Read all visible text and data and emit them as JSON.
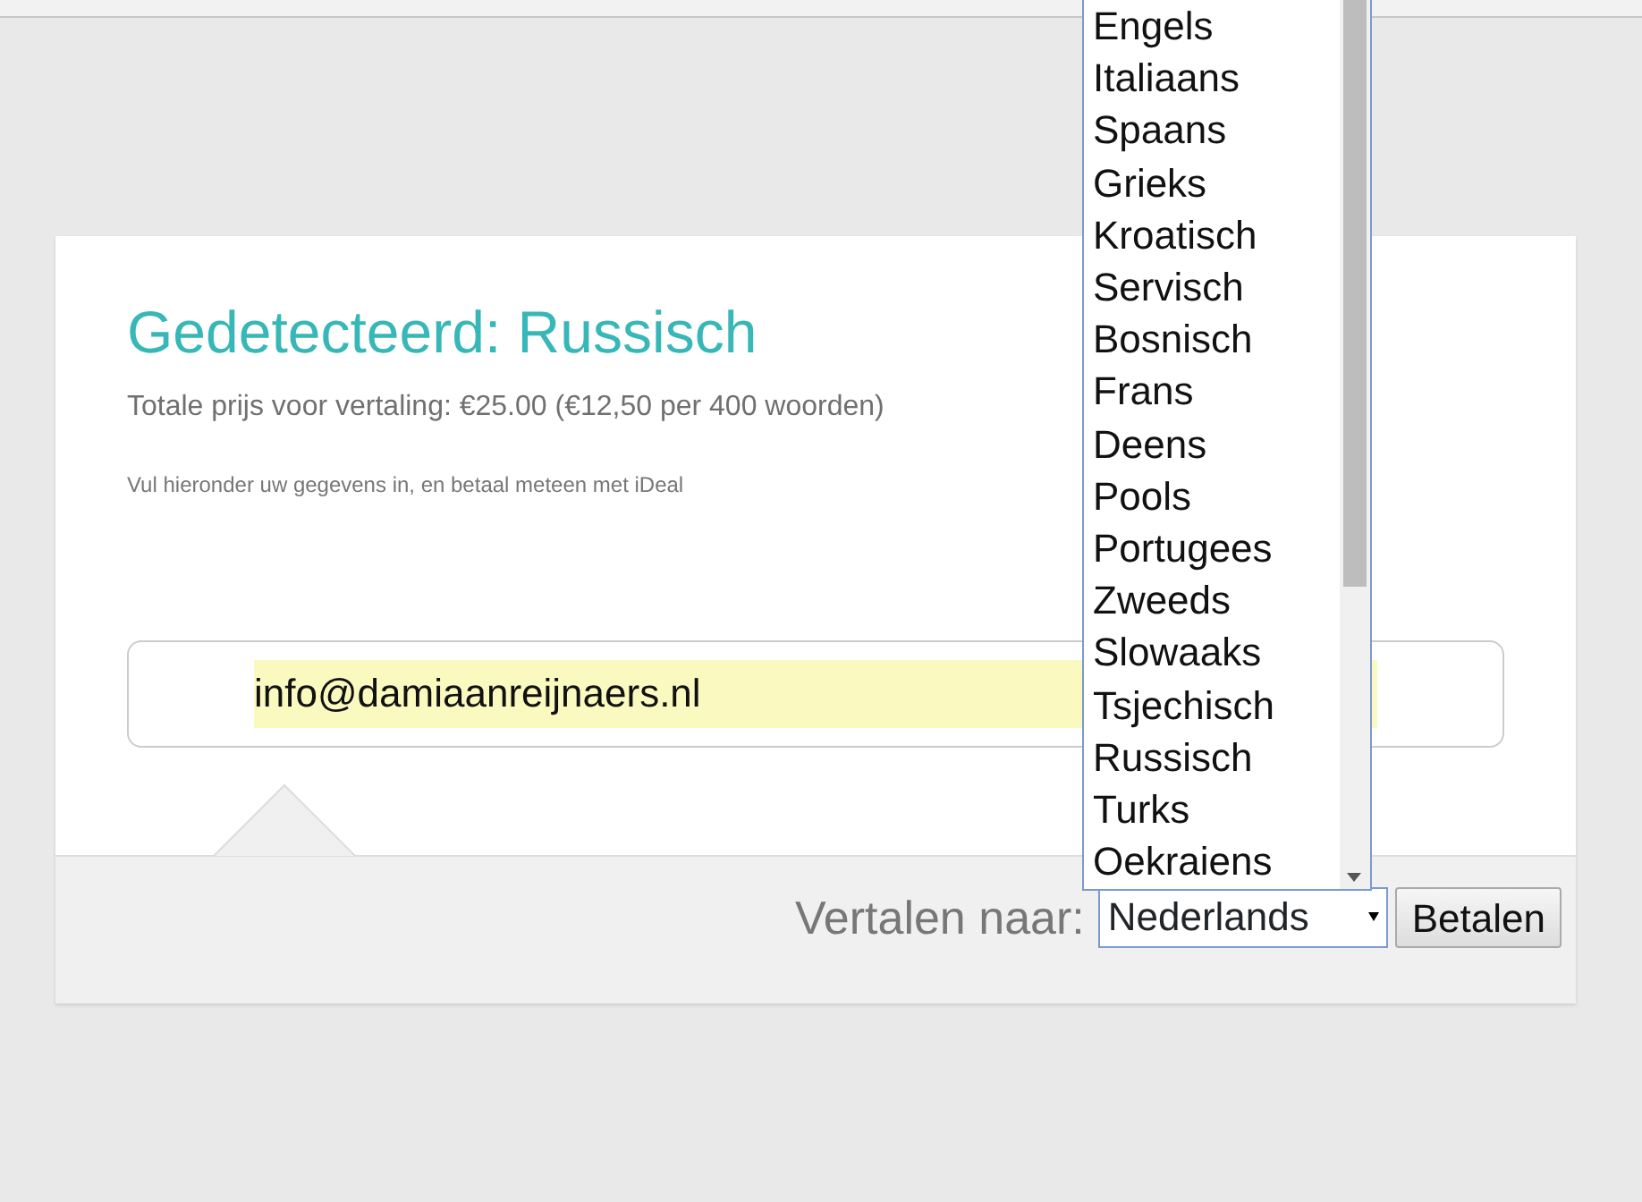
{
  "detected_title": "Gedetecteerd: Russisch",
  "price_text": "Totale prijs voor vertaling: €25.00 (€12,50 per 400 woorden)",
  "instruction_text": "Vul hieronder uw gegevens in, en betaal meteen met iDeal",
  "email_field": {
    "value": "info@damiaanreijnaers.nl"
  },
  "footer": {
    "label": "Vertalen naar:",
    "select": {
      "value": "Nederlands"
    },
    "pay_button": "Betalen"
  },
  "language_dropdown": {
    "options": [
      "Engels",
      "Italiaans",
      "Spaans",
      "Grieks",
      "Kroatisch",
      "Servisch",
      "Bosnisch",
      "Frans",
      "Deens",
      "Pools",
      "Portugees",
      "Zweeds",
      "Slowaaks",
      "Tsjechisch",
      "Russisch",
      "Turks",
      "Oekraiens"
    ]
  }
}
